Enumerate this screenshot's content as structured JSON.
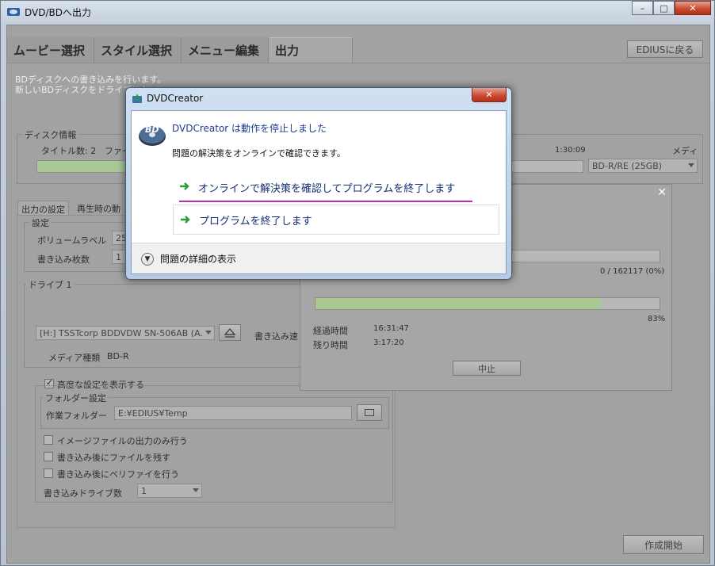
{
  "window": {
    "title": "DVD/BDへ出力",
    "controls": [
      "–",
      "□",
      "✕"
    ]
  },
  "tabs": [
    "ムービー選択",
    "スタイル選択",
    "メニュー編集",
    "出力"
  ],
  "edius_button": "EDIUSに戻る",
  "description": [
    "BDディスクへの書き込みを行います。",
    "新しいBDディスクをドライブに入"
  ],
  "disc_info": {
    "label": "ディスク情報",
    "title_count": "タイトル数: 2",
    "file_label": "ファイル",
    "duration": "1:30:09",
    "media_label": "メディア",
    "media_value": "BD-R/RE (25GB)"
  },
  "settings_tabs": [
    "出力の設定",
    "再生時の動"
  ],
  "settings": {
    "label": "設定",
    "volume_label": "ボリュームラベル",
    "volume_value": "25",
    "copies_label": "書き込み枚数",
    "copies_value": "1"
  },
  "drive": {
    "label": "ドライブ 1",
    "device": "[H:] TSSTcorp BDDVDW SN-506AB (A...",
    "eject_icon": "eject-icon",
    "write_speed_label": "書き込み速",
    "media_type_label": "メディア種類",
    "media_type_value": "BD-R"
  },
  "advanced": {
    "checkbox_label": "高度な設定を表示する",
    "checked": true,
    "folder_group_label": "フォルダー設定",
    "work_folder_label": "作業フォルダー",
    "work_folder_value": "E:¥EDIUS¥Temp",
    "options": [
      "イメージファイルの出力のみ行う",
      "書き込み後にファイルを残す",
      "書き込み後にベリファイを行う"
    ],
    "drive_count_label": "書き込みドライブ数",
    "drive_count_value": "1"
  },
  "progress_window": {
    "counter": "0 / 162117 (0%)",
    "percent": "83%",
    "fill_fraction": 0.83,
    "elapsed_label": "経過時間",
    "elapsed_value": "16:31:47",
    "remaining_label": "残り時間",
    "remaining_value": "3:17:20",
    "cancel_label": "中止"
  },
  "create_button": "作成開始",
  "dialog": {
    "title": "DVDCreator",
    "close": "✕",
    "heading": "DVDCreator は動作を停止しました",
    "sub": "問題の解決策をオンラインで確認できます。",
    "option1": "オンラインで解決策を確認してプログラムを終了します",
    "option2": "プログラムを終了します",
    "details": "問題の詳細の表示",
    "accent_underline": "#b72fb0"
  }
}
